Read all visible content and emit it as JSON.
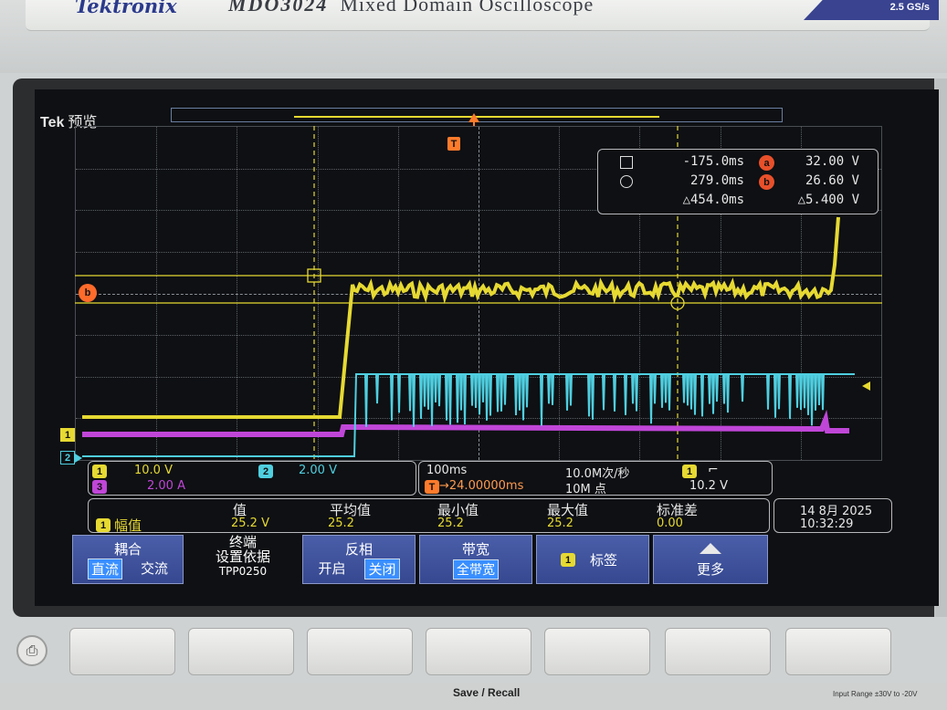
{
  "header": {
    "brand": "Tektronix",
    "model": "MDO3024",
    "model_desc": "Mixed Domain Oscilloscope",
    "sample_rate": "2.5 GS/s"
  },
  "screen": {
    "title_brand": "Tek",
    "title_mode": "预览"
  },
  "markers": {
    "trigger": "T",
    "cursor_b": "b",
    "ch1": "1",
    "ch2": "2"
  },
  "cursor_readout": {
    "a_time": "-175.0ms",
    "a_label": "a",
    "a_value": "32.00 V",
    "b_time": "279.0ms",
    "b_label": "b",
    "b_value": "26.60 V",
    "delta_time": "△454.0ms",
    "delta_value": "△5.400 V"
  },
  "channels": {
    "ch1_tag": "1",
    "ch1_scale": "10.0 V",
    "ch2_tag": "2",
    "ch2_scale": "2.00 V",
    "ch3_tag": "3",
    "ch3_scale": "2.00 A"
  },
  "timebase": {
    "scale": "100ms",
    "sample_rate": "10.0M次/秒",
    "trigger_source_tag": "1",
    "trigger_slope": "⌐",
    "position": "→24.00000ms",
    "record_length": "10M 点",
    "trigger_level": "10.2 V"
  },
  "measurement": {
    "headers": [
      "值",
      "平均值",
      "最小值",
      "最大值",
      "标准差"
    ],
    "source_tag": "1",
    "name": "幅值",
    "value": "25.2 V",
    "mean": "25.2",
    "min": "25.2",
    "max": "25.2",
    "std": "0.00"
  },
  "datetime": {
    "date": "14 8月 2025",
    "time": "10:32:29"
  },
  "softkeys": {
    "coupling_title": "耦合",
    "coupling_dc": "直流",
    "coupling_ac": "交流",
    "term_title": "终端",
    "term_sub": "设置依据",
    "term_probe": "TPP0250",
    "invert_title": "反相",
    "invert_on": "开启",
    "invert_off": "关闭",
    "bw_title": "带宽",
    "bw_value": "全带宽",
    "label_tag": "1",
    "label_title": "标签",
    "more_title": "更多"
  },
  "panel": {
    "save_recall": "Save / Recall",
    "input_range": "Input Range ±30V to -20V"
  },
  "colors": {
    "ch1": "#e6d932",
    "ch2": "#4fcfe0",
    "ch3": "#c046d8",
    "accent": "#ff7b2c",
    "menu_blue": "#3f52a0"
  }
}
